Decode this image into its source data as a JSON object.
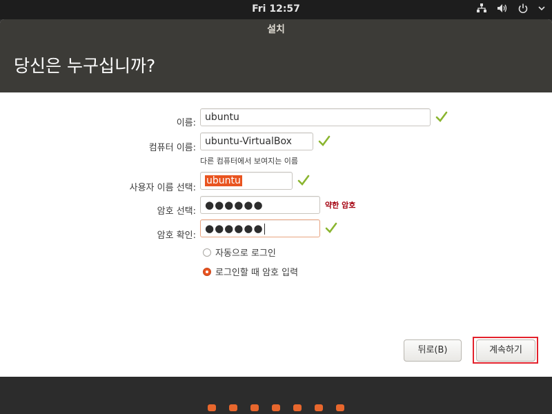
{
  "system_bar": {
    "clock": "Fri 12:57",
    "icons": [
      "network-icon",
      "volume-icon",
      "power-icon",
      "chevron-down-icon"
    ]
  },
  "window": {
    "title": "설치",
    "heading": "당신은 누구십니까?"
  },
  "form": {
    "name": {
      "label": "이름:",
      "value": "ubuntu"
    },
    "computer_name": {
      "label": "컴퓨터 이름:",
      "value": "ubuntu-VirtualBox",
      "hint": "다른 컴퓨터에서 보여지는 이름"
    },
    "username": {
      "label": "사용자 이름 선택:",
      "value": "ubuntu"
    },
    "password": {
      "label": "암호 선택:",
      "value": "●●●●●●",
      "strength": "약한 암호"
    },
    "confirm_password": {
      "label": "암호 확인:",
      "value": "●●●●●●"
    },
    "login_options": [
      {
        "label": "자동으로 로그인",
        "selected": false
      },
      {
        "label": "로그인할 때 암호 입력",
        "selected": true
      }
    ]
  },
  "buttons": {
    "back": "뒤로(B)",
    "continue": "계속하기"
  },
  "colors": {
    "accent": "#e95420",
    "check": "#8ab52f",
    "weak_password": "#a4000f",
    "highlight": "#e3212b"
  },
  "progress_steps": 7
}
